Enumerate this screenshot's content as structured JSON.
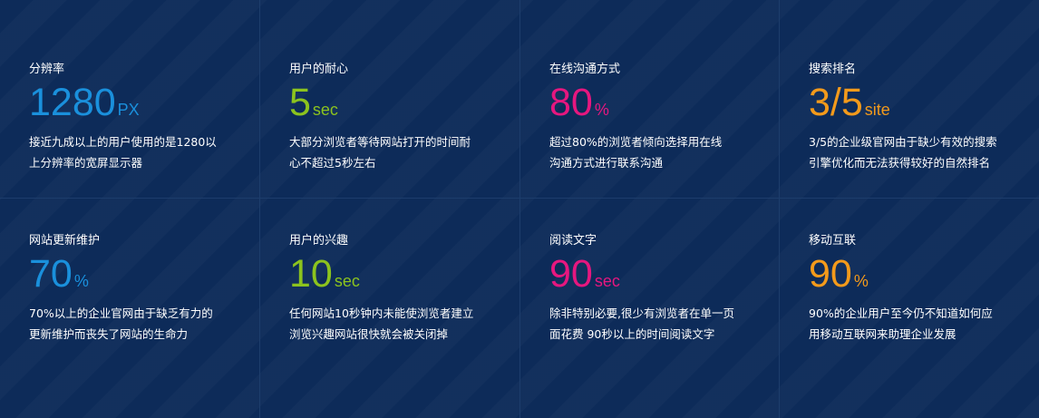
{
  "colors": {
    "background": "#0d2b59",
    "blue": "#1a90dc",
    "green": "#8cc31e",
    "magenta": "#e6177f",
    "orange": "#f39a1b"
  },
  "stats": [
    {
      "label": "分辨率",
      "value": "1280",
      "unit": "PX",
      "color": "#1a90dc",
      "lines": [
        "接近九成以上的用户使用的是1280以",
        "上分辨率的宽屏显示器"
      ]
    },
    {
      "label": "用户的耐心",
      "value": "5",
      "unit": "sec",
      "color": "#8cc31e",
      "lines": [
        "大部分浏览者等待网站打开的时间耐",
        "心不超过5秒左右"
      ]
    },
    {
      "label": "在线沟通方式",
      "value": "80",
      "unit": "%",
      "color": "#e6177f",
      "lines": [
        "超过80%的浏览者倾向选择用在线",
        "沟通方式进行联系沟通"
      ]
    },
    {
      "label": "搜索排名",
      "value": "3/5",
      "unit": "site",
      "color": "#f39a1b",
      "lines": [
        "3/5的企业级官网由于缺少有效的搜索",
        "引擎优化而无法获得较好的自然排名"
      ]
    },
    {
      "label": "网站更新维护",
      "value": "70",
      "unit": "%",
      "color": "#1a90dc",
      "lines": [
        "70%以上的企业官网由于缺乏有力的",
        "更新维护而丧失了网站的生命力"
      ]
    },
    {
      "label": "用户的兴趣",
      "value": "10",
      "unit": "sec",
      "color": "#8cc31e",
      "lines": [
        "任何网站10秒钟内未能使浏览者建立",
        "浏览兴趣网站很快就会被关闭掉"
      ]
    },
    {
      "label": "阅读文字",
      "value": "90",
      "unit": "sec",
      "color": "#e6177f",
      "lines": [
        "除非特别必要,很少有浏览者在单一页",
        "面花费 90秒以上的时间阅读文字"
      ]
    },
    {
      "label": "移动互联",
      "value": "90",
      "unit": "%",
      "color": "#f39a1b",
      "lines": [
        "90%的企业用户至今仍不知道如何应",
        "用移动互联网来助理企业发展"
      ]
    }
  ]
}
